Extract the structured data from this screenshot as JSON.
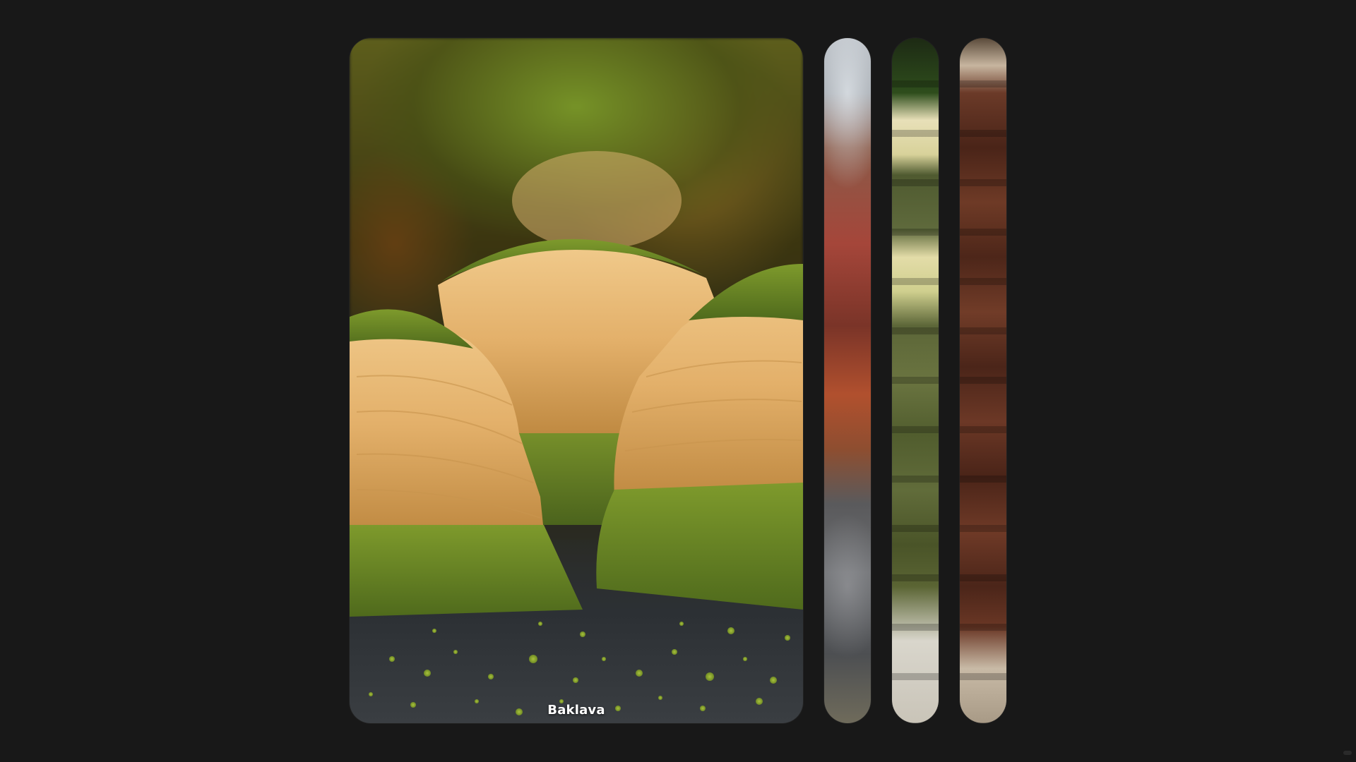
{
  "gallery": {
    "active_index": 0,
    "items": [
      {
        "label": "Baklava",
        "state": "expanded"
      },
      {
        "label": "",
        "state": "collapsed"
      },
      {
        "label": "",
        "state": "collapsed"
      },
      {
        "label": "",
        "state": "collapsed"
      }
    ]
  },
  "colors": {
    "page_background": "#181818",
    "caption_text": "#ffffff"
  }
}
